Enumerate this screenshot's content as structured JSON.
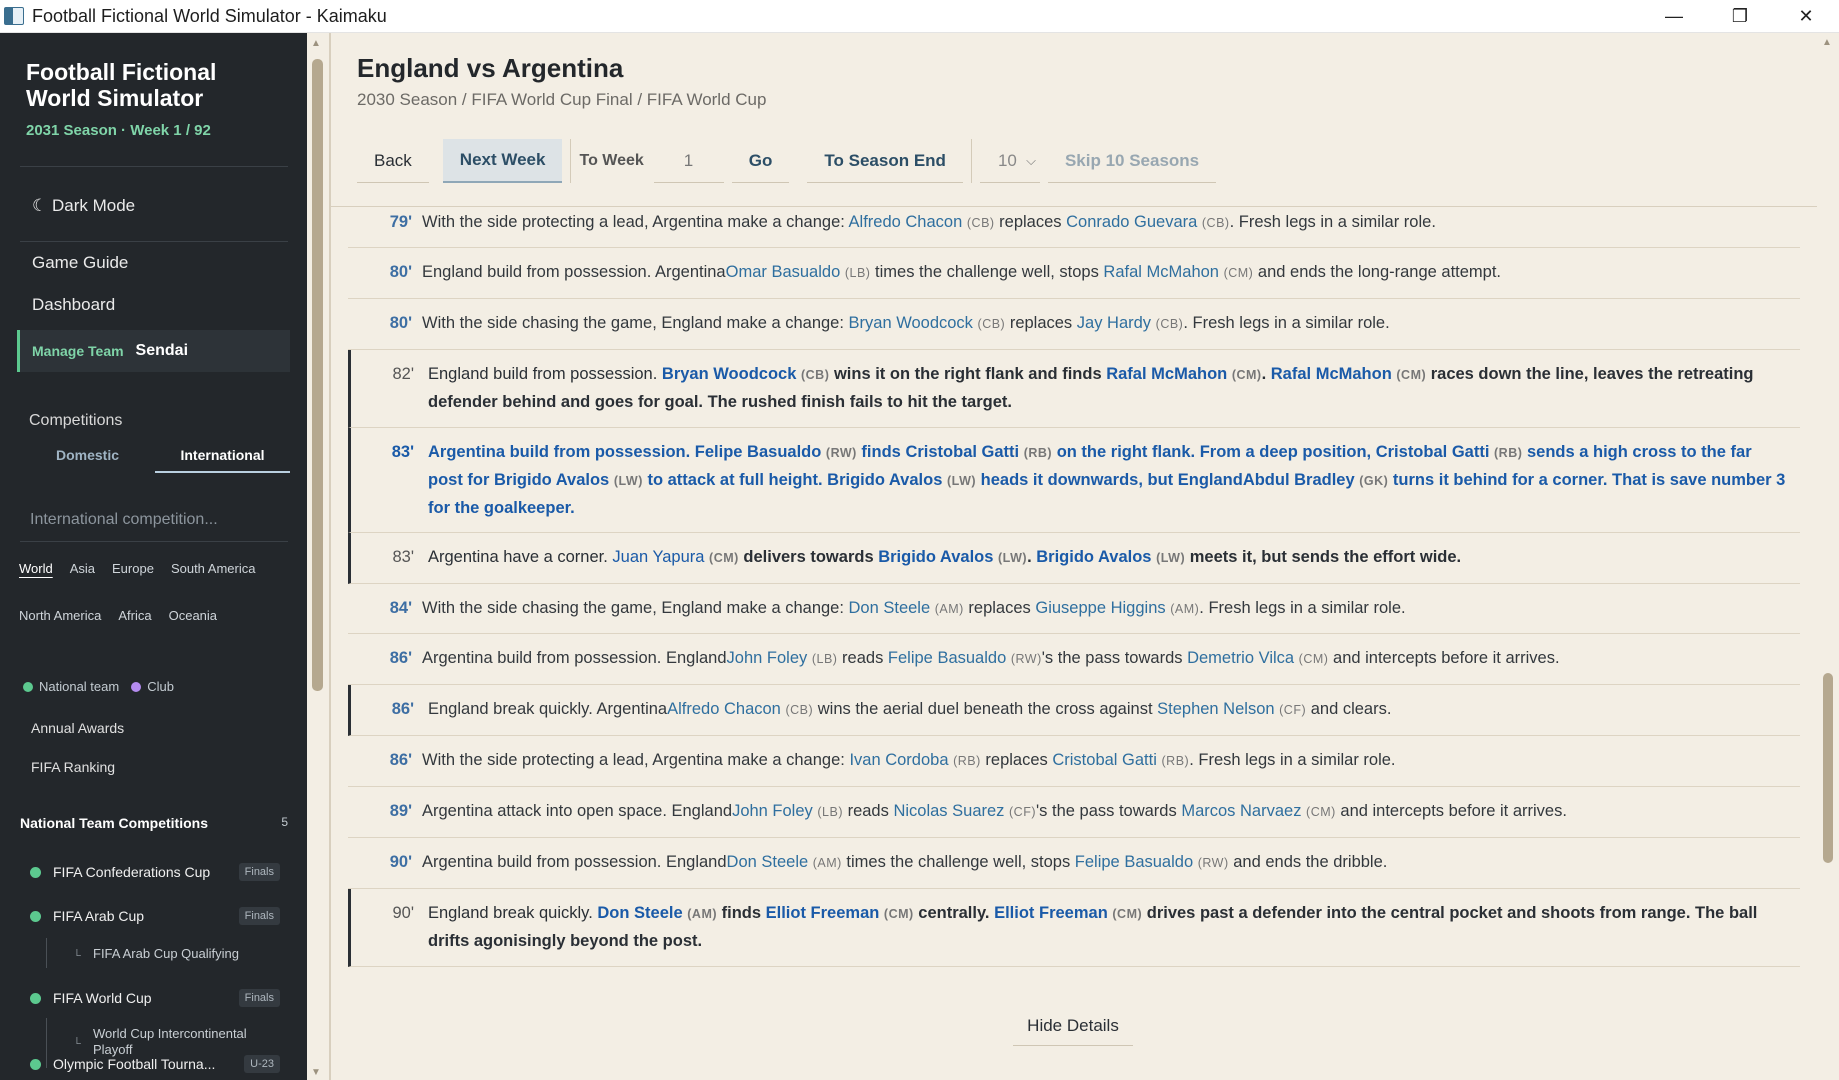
{
  "window": {
    "title": "Football Fictional World Simulator - Kaimaku"
  },
  "sidebar": {
    "app_title": "Football Fictional World Simulator",
    "season_line": "2031 Season · Week 1 / 92",
    "dark_mode": "☾ Dark Mode",
    "game_guide": "Game Guide",
    "dashboard": "Dashboard",
    "manage_team_label": "Manage Team",
    "manage_team_name": "Sendai",
    "competitions_label": "Competitions",
    "tab_domestic": "Domestic",
    "tab_international": "International",
    "search_placeholder": "International competition...",
    "regions_row1": [
      "World",
      "Asia",
      "Europe",
      "South America"
    ],
    "regions_row2": [
      "North America",
      "Africa",
      "Oceania"
    ],
    "legend_national": "National team",
    "legend_club": "Club",
    "annual_awards": "Annual Awards",
    "fifa_ranking": "FIFA Ranking",
    "ntc_header": "National Team Competitions",
    "ntc_count": "5",
    "competitions": [
      {
        "name": "FIFA Confederations Cup",
        "badge": "Finals"
      },
      {
        "name": "FIFA Arab Cup",
        "badge": "Finals"
      },
      {
        "name": "FIFA Arab Cup Qualifying"
      },
      {
        "name": "FIFA World Cup",
        "badge": "Finals"
      },
      {
        "name": "World Cup Intercontinental Playoff"
      },
      {
        "name": "Olympic Football Tourna...",
        "badge": "U-23"
      }
    ]
  },
  "main": {
    "title": "England vs Argentina",
    "breadcrumb": "2030 Season / FIFA World Cup Final / FIFA World Cup",
    "toolbar": {
      "back": "Back",
      "next_week": "Next Week",
      "to_week_label": "To Week",
      "to_week_value": "1",
      "go": "Go",
      "to_season_end": "To Season End",
      "skip_select": "10",
      "skip_seasons": "Skip 10 Seasons"
    },
    "hide_details": "Hide Details"
  },
  "colors": {
    "sidebar_bg": "#23272b",
    "accent_green": "#5cc98f",
    "link_blue": "#2f6f9f",
    "key_blue": "#1a5aa8",
    "page_bg": "#f3eee4"
  }
}
